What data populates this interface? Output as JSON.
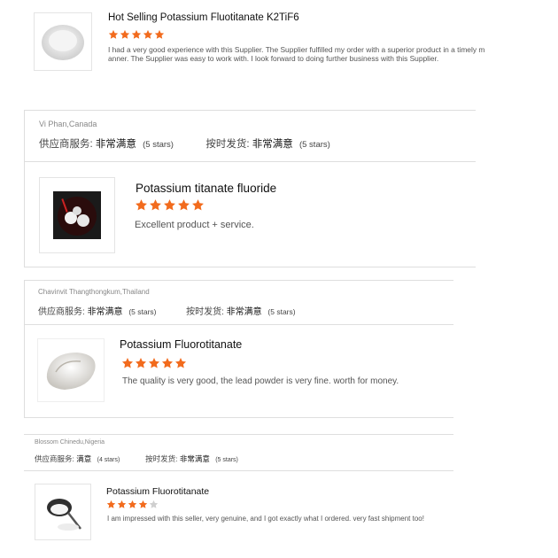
{
  "card1": {
    "product_name": "Hot Selling Potassium Fluotitanate K2TiF6",
    "rating": 5,
    "review": "I had a very good experience with this Supplier.  The Supplier fulfilled my order with a superior product in a timely manner.  The Supplier was easy to work with.  I look forward to doing further business with this Supplier."
  },
  "card2": {
    "reviewer": "Vi Phan,Canada",
    "supplier_service_label": "供应商服务:",
    "supplier_service_value": "非常满意",
    "supplier_service_stars": "(5 stars)",
    "ontime_label": "按时发货:",
    "ontime_value": "非常满意",
    "ontime_stars": "(5 stars)",
    "product_name": "Potassium titanate fluoride",
    "rating": 5,
    "review": "Excellent product + service."
  },
  "card3": {
    "reviewer": "Chavinvit Thangthongkum,Thailand",
    "supplier_service_label": "供应商服务:",
    "supplier_service_value": "非常满意",
    "supplier_service_stars": "(5 stars)",
    "ontime_label": "按时发货:",
    "ontime_value": "非常满意",
    "ontime_stars": "(5 stars)",
    "product_name": "Potassium Fluorotitanate",
    "rating": 5,
    "review": "The quality is very good, the lead powder is very fine. worth for money."
  },
  "card4": {
    "reviewer": "Blossom Chinedu,Nigeria",
    "supplier_service_label": "供应商服务:",
    "supplier_service_value": "满意",
    "supplier_service_stars": "(4 stars)",
    "ontime_label": "按时发货:",
    "ontime_value": "非常满意",
    "ontime_stars": "(5 stars)",
    "product_name": "Potassium Fluorotitanate",
    "rating": 4,
    "review": "I am impressed with this seller,  very genuine, and I got exactly what I ordered.  very fast shipment too!"
  },
  "colors": {
    "star_on": "#f26b1d",
    "star_off": "#cfcfcf"
  }
}
